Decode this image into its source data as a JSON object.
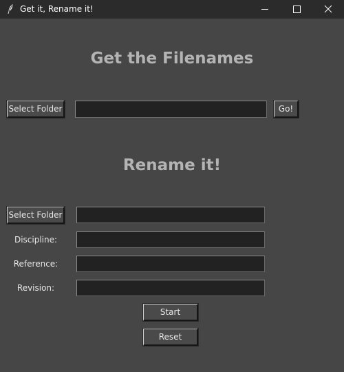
{
  "window": {
    "title": "Get it, Rename it!",
    "icon": "feather-icon"
  },
  "get_section": {
    "heading": "Get the Filenames",
    "select_folder_label": "Select Folder",
    "path_value": "",
    "go_label": "Go!"
  },
  "rename_section": {
    "heading": "Rename it!",
    "select_folder_label": "Select Folder",
    "folder_value": "",
    "discipline_label": "Discipline:",
    "discipline_value": "",
    "reference_label": "Reference:",
    "reference_value": "",
    "revision_label": "Revision:",
    "revision_value": "",
    "start_label": "Start",
    "reset_label": "Reset"
  }
}
